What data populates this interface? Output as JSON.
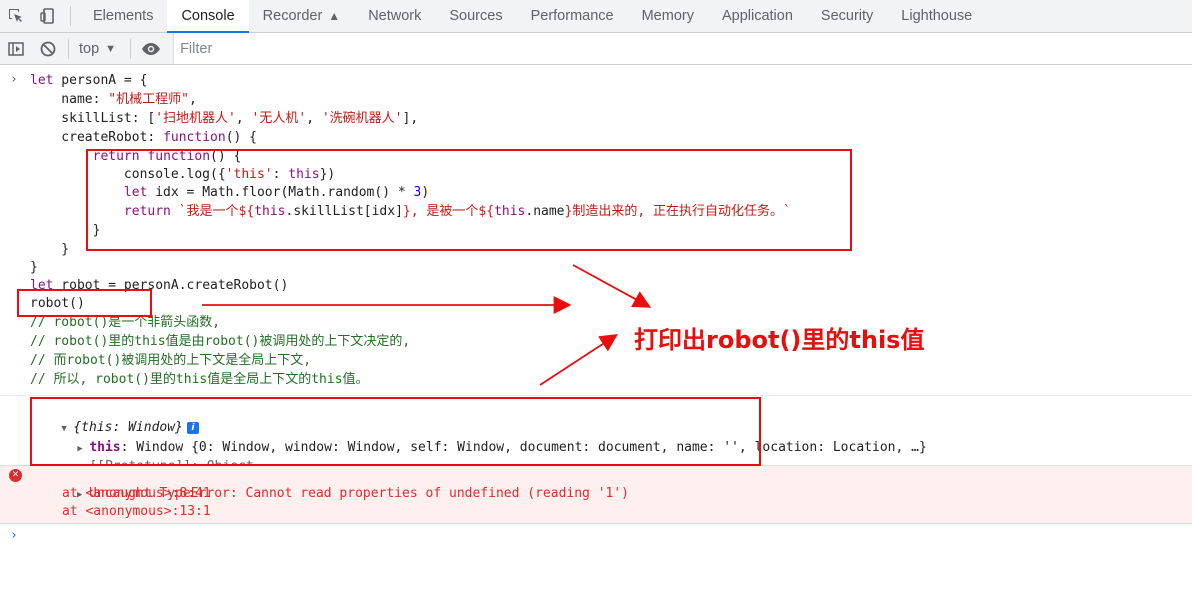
{
  "tabs": [
    "Elements",
    "Console",
    "Recorder",
    "Network",
    "Sources",
    "Performance",
    "Memory",
    "Application",
    "Security",
    "Lighthouse"
  ],
  "active_tab": "Console",
  "toolbar": {
    "context": "top",
    "filter_placeholder": "Filter"
  },
  "code": [
    "let personA = {",
    "    name: \"机械工程师\",",
    "    skillList: ['扫地机器人', '无人机', '洗碗机器人'],",
    "    createRobot: function() {",
    "        return function() {",
    "            console.log({'this': this})",
    "            let idx = Math.floor(Math.random() * 3)",
    "            return `我是一个${this.skillList[idx]}, 是被一个${this.name}制造出来的, 正在执行自动化任务。`",
    "        }",
    "    }",
    "}",
    "let robot = personA.createRobot()",
    "robot()"
  ],
  "comments": [
    "// robot()是一个非箭头函数,",
    "// robot()里的this值是由robot()被调用处的上下文决定的,",
    "// 而robot()被调用处的上下文是全局上下文,",
    "// 所以, robot()里的this值是全局上下文的this值。"
  ],
  "log": {
    "summary": "{this: Window}",
    "this_key": "this",
    "this_value": "Window {0: Window, window: Window, self: Window, document: document, name: '', location: Location, …}",
    "prototype": "[[Prototype]]: Object"
  },
  "error": {
    "message": "Uncaught TypeError: Cannot read properties of undefined (reading '1')",
    "stack": [
      "at <anonymous>:8:41",
      "at <anonymous>:13:1"
    ]
  },
  "annotation": "打印出robot()里的this值",
  "colors": {
    "annotation_red": "#e80e0e",
    "error_red": "#e12b2b",
    "active_tab_blue": "#1a73e8"
  },
  "icons": [
    "inspect-icon",
    "device-toggle-icon",
    "sidebar-icon",
    "clear-console-icon",
    "dropdown-arrow-icon",
    "eye-icon",
    "info-icon",
    "error-icon",
    "prompt-chevron-icon"
  ]
}
